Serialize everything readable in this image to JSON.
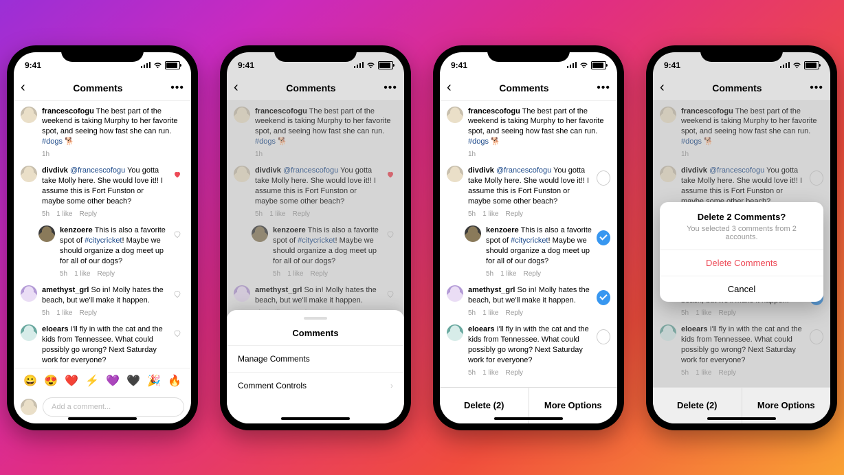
{
  "status_time": "9:41",
  "nav": {
    "title": "Comments",
    "dots": "•••"
  },
  "comments": {
    "c1": {
      "user": "francescofogu",
      "text": "The best part of the weekend is taking Murphy to her favorite spot, and seeing how fast she can run.",
      "tag": "#dogs",
      "emoji": "🐕",
      "time": "1h"
    },
    "c2": {
      "user": "divdivk",
      "mention": "@francescofogu",
      "text": "You gotta take Molly here. She would love it!! I assume this is Fort Funston or maybe some other beach?",
      "time": "5h",
      "likes": "1 like",
      "reply": "Reply"
    },
    "c3": {
      "user": "kenzoere",
      "text": "This is also a favorite spot of",
      "tag": "#citycricket",
      "text2": "! Maybe we should organize a dog meet up for all of our dogs?",
      "time": "5h",
      "likes": "1 like",
      "reply": "Reply"
    },
    "c4": {
      "user": "amethyst_grl",
      "text": "So in! Molly hates the beach, but we'll make it happen.",
      "time": "5h",
      "likes": "1 like",
      "reply": "Reply"
    },
    "c5": {
      "user": "eloears",
      "text": "I'll fly in with the cat and the kids from Tennessee. What could possibly go wrong? Next Saturday work for everyone?",
      "time": "5h",
      "likes": "1 like",
      "reply": "Reply"
    }
  },
  "quick_emoji": [
    "😀",
    "😍",
    "❤️",
    "⚡",
    "💜",
    "🖤",
    "🎉",
    "🔥"
  ],
  "input_placeholder": "Add a comment...",
  "sheet": {
    "title": "Comments",
    "row1": "Manage Comments",
    "row2": "Comment Controls"
  },
  "actions": {
    "delete": "Delete (2)",
    "more": "More Options"
  },
  "alert": {
    "title": "Delete 2 Comments?",
    "sub": "You selected 3 comments from 2 accounts.",
    "delete": "Delete Comments",
    "cancel": "Cancel"
  }
}
